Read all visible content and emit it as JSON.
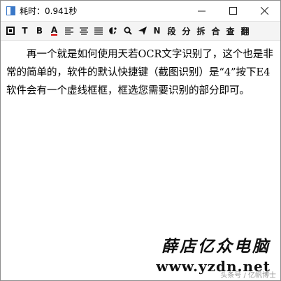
{
  "window": {
    "title": "耗时：0.941秒",
    "minimize": "—",
    "maximize": "☐",
    "close": "✕"
  },
  "toolbar": {
    "items": [
      {
        "name": "copy-icon"
      },
      {
        "label": "T"
      },
      {
        "label": "B"
      },
      {
        "label": "A"
      },
      {
        "name": "align-left-icon"
      },
      {
        "name": "align-center-icon"
      },
      {
        "name": "align-justify-icon"
      },
      {
        "name": "palette-icon"
      },
      {
        "name": "search-icon"
      },
      {
        "name": "send-icon"
      },
      {
        "label": "N"
      },
      {
        "label": "段"
      },
      {
        "label": "分"
      },
      {
        "label": "拆"
      },
      {
        "label": "合"
      },
      {
        "label": "查"
      },
      {
        "label": "翻"
      }
    ]
  },
  "document": {
    "text": "再一个就是如何使用天若OCR文字识别了，这个也是非常的简单的，软件的默认快捷键（截图识别）是“4”按下E4软件会有一个虚线框框，框选您需要识别的部分即可。"
  },
  "watermark": {
    "brand": "薛店亿众电脑",
    "url": "www.yzdn.net",
    "sub": "头条号 / 亿帆博士"
  },
  "colors": {
    "accent": "#3a78c8",
    "toolbar_bg": "#f4f4f4"
  }
}
